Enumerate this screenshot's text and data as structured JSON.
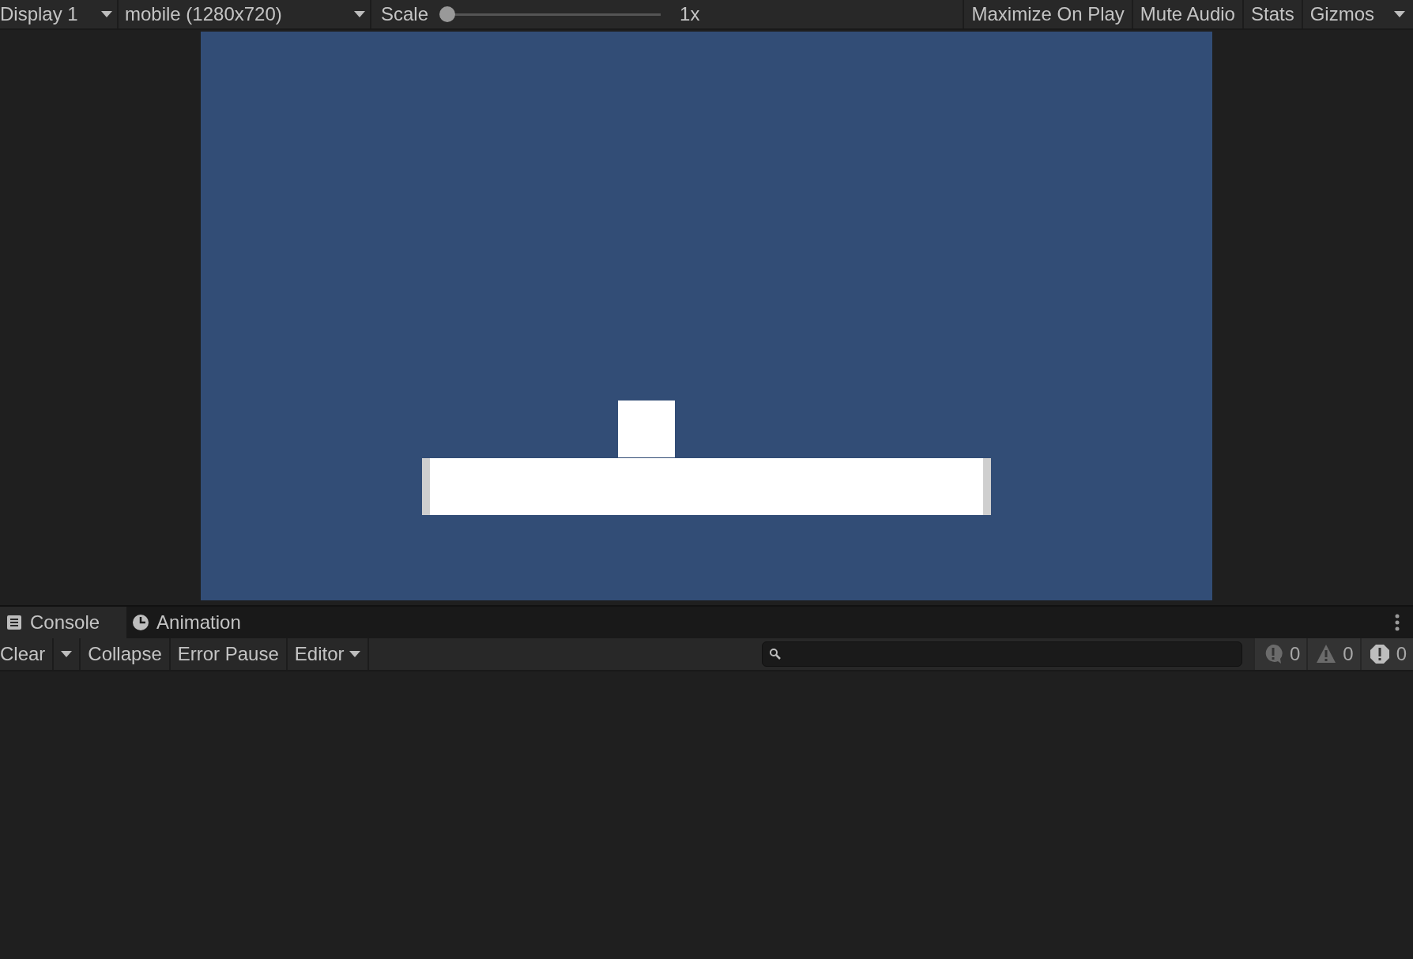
{
  "game_toolbar": {
    "display": "Display 1",
    "resolution": "mobile (1280x720)",
    "scale": {
      "label": "Scale",
      "level": 0,
      "reading": "1x"
    },
    "buttons": [
      "Maximize On Play",
      "Mute Audio",
      "Stats",
      "Gizmos"
    ]
  },
  "console_tabs": [
    {
      "label": "Console",
      "kind": "console",
      "selected": true
    },
    {
      "label": "Animation",
      "kind": "animation",
      "selected": false
    }
  ],
  "console_toolbar": {
    "clear": "Clear",
    "buttons": [
      "Collapse",
      "Error Pause"
    ],
    "editor": "Editor",
    "counters": [
      {
        "kind": "info",
        "count": "0"
      },
      {
        "kind": "warning",
        "count": "0"
      },
      {
        "kind": "error",
        "count": "0"
      }
    ]
  }
}
